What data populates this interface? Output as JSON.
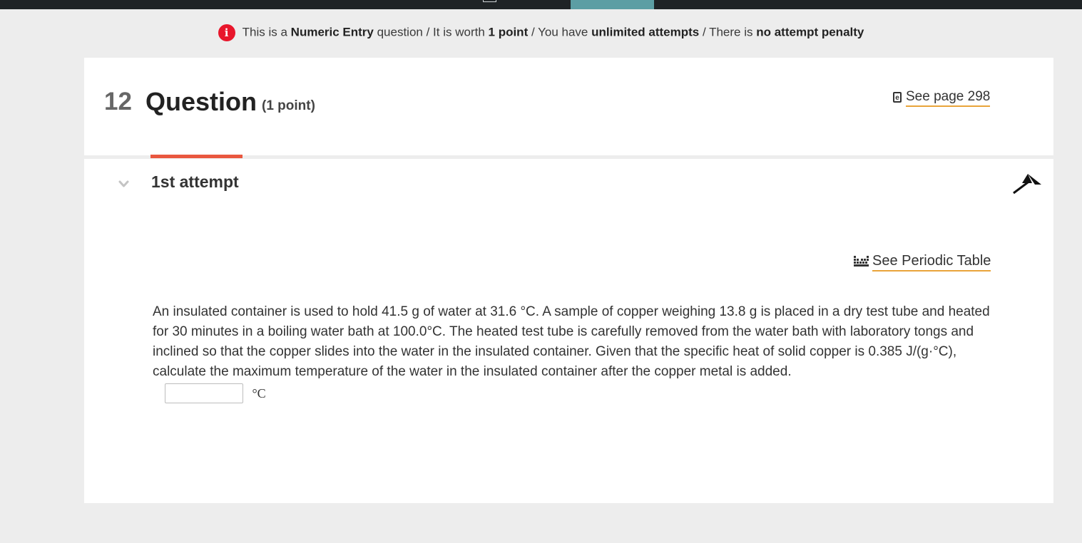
{
  "banner": {
    "icon": "info-icon",
    "icon_glyph": "i",
    "icon_color": "#e8162b",
    "t1": "This is a ",
    "b1": "Numeric Entry",
    "t2": " question / It is worth ",
    "b2": "1 point",
    "t3": " / You have ",
    "b3": "unlimited attempts",
    "t4": " / There is ",
    "b4": "no attempt penalty"
  },
  "question": {
    "number": "12",
    "title": "Question",
    "points": "(1 point)",
    "see_page_icon": "ebook-icon",
    "see_page_icon_glyph": "e",
    "see_page_label": "See page 298",
    "link_underline_color": "#e9a43a"
  },
  "attempt": {
    "label": "1st attempt",
    "tab_color": "#e9573f",
    "periodic_label": "See Periodic Table",
    "prompt": "An insulated container is used to hold 41.5  g of water at 31.6 °C. A sample of copper weighing 13.8  g is placed in a dry test tube and heated for 30 minutes in a boiling water bath at 100.0°C. The heated test tube is carefully removed from the water bath with laboratory tongs and inclined so that the copper slides into the water in the insulated container. Given that the specific heat of solid copper is 0.385 J/(g·°C), calculate the maximum temperature of the water in the insulated container after the copper metal is added.",
    "answer_value": "",
    "unit": "°C"
  }
}
